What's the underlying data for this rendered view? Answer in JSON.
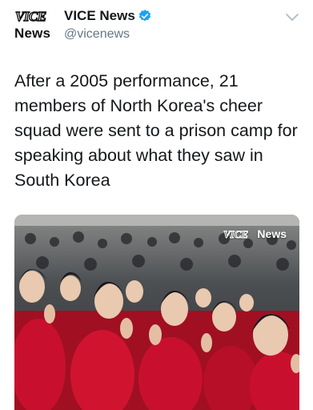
{
  "account": {
    "avatar_logo": "VICE",
    "avatar_word": "News",
    "display_name": "VICE News",
    "handle": "@vicenews",
    "verified": true
  },
  "tweet": {
    "text": "After a 2005 performance, 21 members of North Korea's cheer squad were sent to a prison camp for speaking about what they saw in South Korea"
  },
  "media": {
    "watermark_logo": "VICE",
    "watermark_word": "News"
  },
  "icons": {
    "verified": "verified-badge-icon",
    "menu": "chevron-down-icon"
  },
  "colors": {
    "verified_blue": "#1da1f2",
    "text": "#14171a",
    "secondary": "#657786",
    "squad_red": "#c8102e"
  }
}
